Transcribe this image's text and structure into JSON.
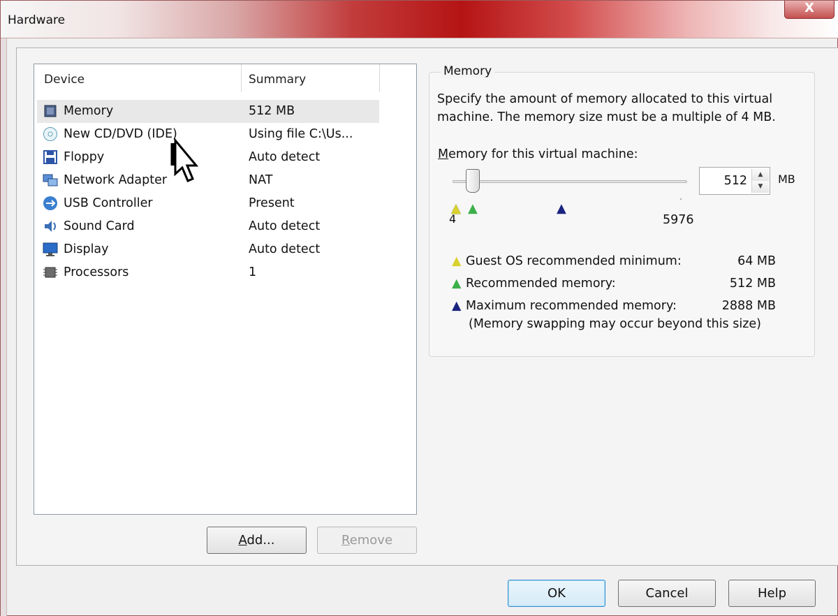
{
  "window": {
    "title": "Hardware",
    "close_glyph": "X"
  },
  "device_list": {
    "columns": [
      "Device",
      "Summary"
    ],
    "rows": [
      {
        "name": "Memory",
        "summary": "512 MB",
        "icon": "memory-icon",
        "selected": true
      },
      {
        "name": "New CD/DVD (IDE)",
        "summary": "Using file C:\\Us...",
        "icon": "cd-dvd-icon"
      },
      {
        "name": "Floppy",
        "summary": "Auto detect",
        "icon": "floppy-icon"
      },
      {
        "name": "Network Adapter",
        "summary": "NAT",
        "icon": "network-adapter-icon"
      },
      {
        "name": "USB Controller",
        "summary": "Present",
        "icon": "usb-icon"
      },
      {
        "name": "Sound Card",
        "summary": "Auto detect",
        "icon": "sound-card-icon"
      },
      {
        "name": "Display",
        "summary": "Auto detect",
        "icon": "display-icon"
      },
      {
        "name": "Processors",
        "summary": "1",
        "icon": "processor-icon"
      }
    ]
  },
  "buttons": {
    "add": {
      "underline": "A",
      "rest": "dd..."
    },
    "remove": {
      "underline": "R",
      "rest": "emove"
    },
    "ok": "OK",
    "cancel": "Cancel",
    "help": "Help"
  },
  "memory": {
    "group_title": "Memory",
    "description": "Specify the amount of memory allocated to this virtual machine. The memory size must be a multiple of 4 MB.",
    "label": {
      "underline": "M",
      "rest": "emory for this virtual machine:"
    },
    "value": "512",
    "unit": "MB",
    "scale_min": "4",
    "scale_max": "5976",
    "slider_fraction": 0.086,
    "legend": [
      {
        "label": "Guest OS recommended minimum:",
        "value": "64 MB",
        "color": "#e8e23a"
      },
      {
        "label": "Recommended memory:",
        "value": "512 MB",
        "color": "#3bb04a"
      },
      {
        "label": "Maximum recommended memory:",
        "value": "2888 MB",
        "color": "#1a237e"
      }
    ],
    "note": "(Memory swapping may occur beyond this size)"
  }
}
